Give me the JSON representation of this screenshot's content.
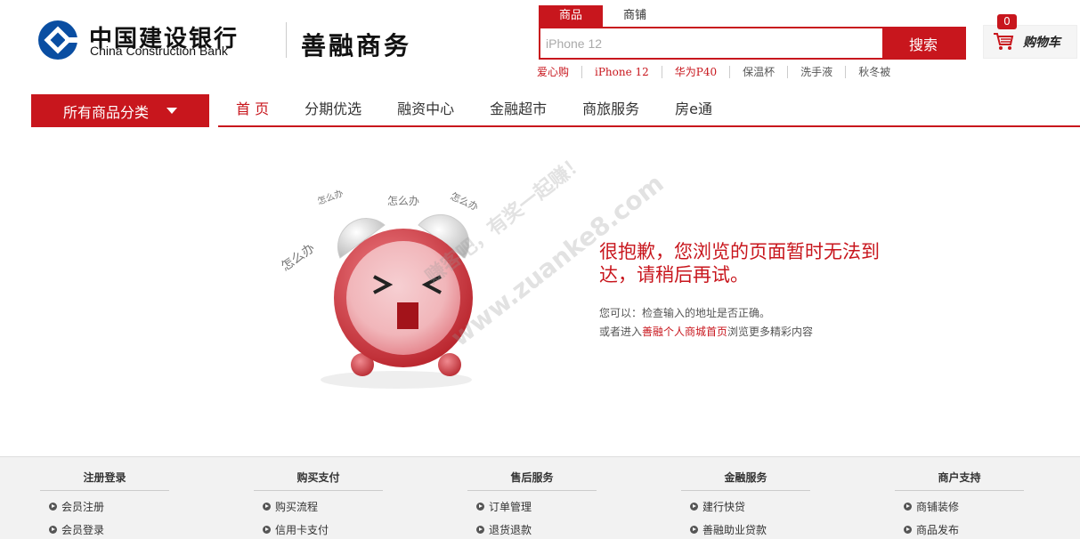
{
  "brand": {
    "bank_cn": "中国建设银行",
    "bank_en": "China Construction Bank",
    "mall": "善融商务"
  },
  "search": {
    "tabs": [
      "商品",
      "商铺"
    ],
    "placeholder": "iPhone 12",
    "button": "搜索",
    "hot_words": [
      "爱心购",
      "iPhone 12",
      "华为P40",
      "保温杯",
      "洗手液",
      "秋冬被"
    ]
  },
  "cart": {
    "label": "购物车",
    "count": "0"
  },
  "nav": {
    "category_button": "所有商品分类",
    "items": [
      "首 页",
      "分期优选",
      "融资中心",
      "金融超市",
      "商旅服务",
      "房e通"
    ]
  },
  "clock_words": [
    "怎么办",
    "怎么办",
    "怎么办",
    "怎么办"
  ],
  "clock_face": {
    "eyes": "> <"
  },
  "error": {
    "title": "很抱歉，您浏览的页面暂时无法到达，请稍后再试。",
    "line1": "您可以：检查输入的地址是否正确。",
    "line2_pre": "或者进入",
    "line2_link": "善融个人商城首页",
    "line2_post": "浏览更多精彩内容"
  },
  "watermark": {
    "line1": "赚客吧，有奖一起赚！",
    "line2": "www.zuanke8.com"
  },
  "footer": {
    "columns": [
      {
        "title": "注册登录",
        "links": [
          "会员注册",
          "会员登录"
        ]
      },
      {
        "title": "购买支付",
        "links": [
          "购买流程",
          "信用卡支付"
        ]
      },
      {
        "title": "售后服务",
        "links": [
          "订单管理",
          "退货退款"
        ]
      },
      {
        "title": "金融服务",
        "links": [
          "建行快贷",
          "善融助业贷款"
        ]
      },
      {
        "title": "商户支持",
        "links": [
          "商铺装修",
          "商品发布"
        ]
      }
    ]
  },
  "colors": {
    "brand_red": "#c8161d",
    "ccb_blue": "#0a4ea2"
  }
}
